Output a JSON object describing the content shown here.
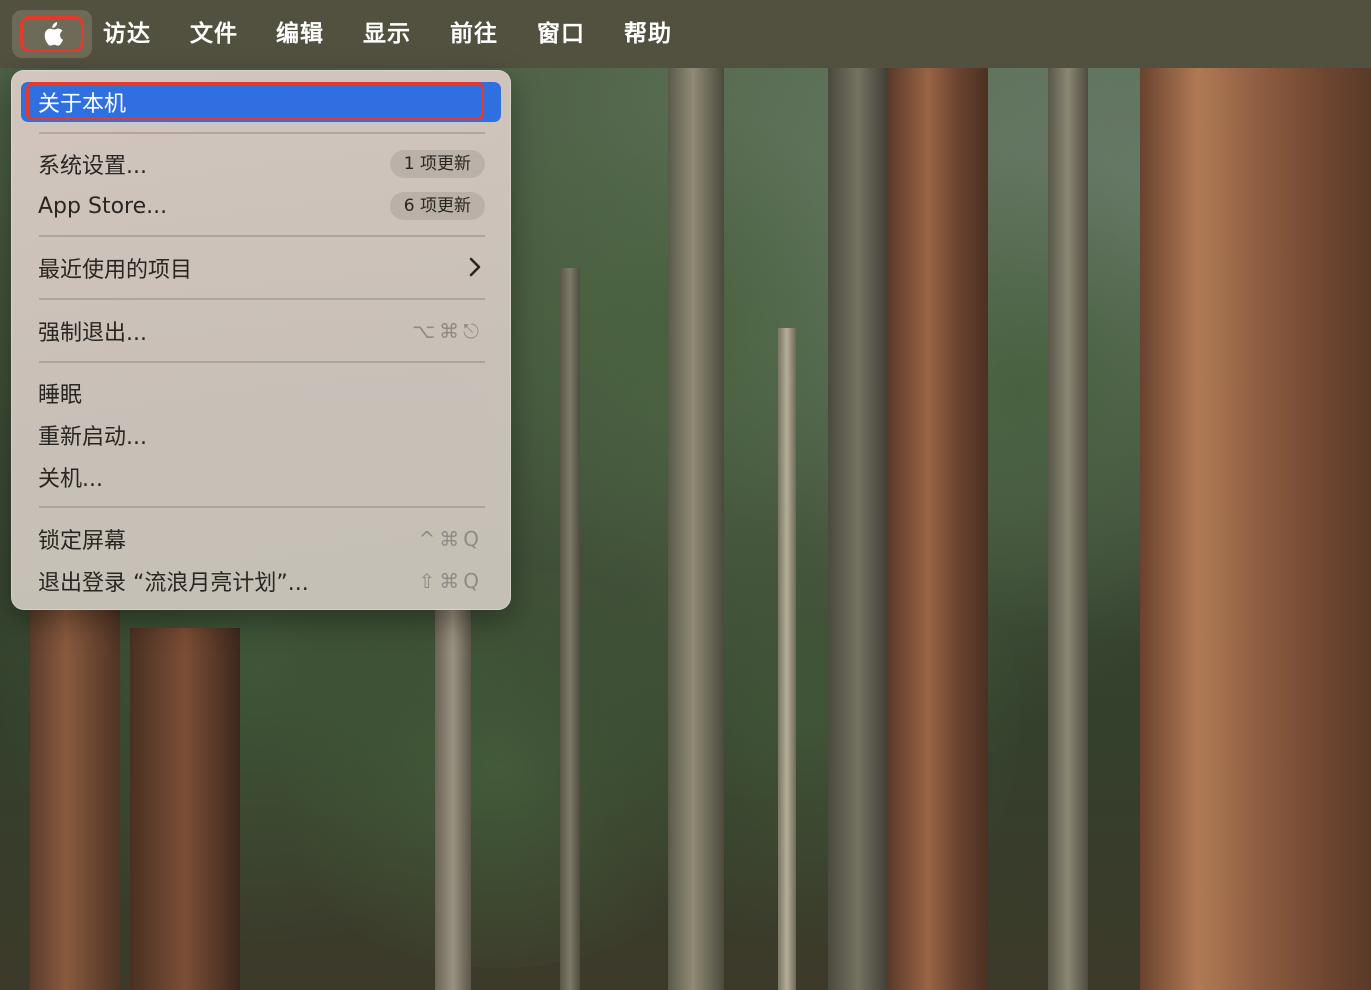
{
  "menubar": {
    "apple_icon": "apple-logo-icon",
    "menus": [
      "访达",
      "文件",
      "编辑",
      "显示",
      "前往",
      "窗口",
      "帮助"
    ]
  },
  "apple_menu": {
    "about": "关于本机",
    "system_settings": {
      "label": "系统设置...",
      "badge": "1 项更新"
    },
    "app_store": {
      "label": "App Store...",
      "badge": "6 项更新"
    },
    "recent_items": {
      "label": "最近使用的项目",
      "icon": "chevron-right-icon"
    },
    "force_quit": {
      "label": "强制退出...",
      "shortcut": "⌥⌘⎋"
    },
    "sleep": "睡眠",
    "restart": "重新启动...",
    "shutdown": "关机...",
    "lock_screen": {
      "label": "锁定屏幕",
      "shortcut": "^⌘Q"
    },
    "log_out": {
      "label": "退出登录 “流浪月亮计划”...",
      "shortcut": "⇧⌘Q"
    }
  },
  "colors": {
    "menubar": "#52503f",
    "highlight": "#2f6fe0",
    "annotation": "#e6382b"
  }
}
